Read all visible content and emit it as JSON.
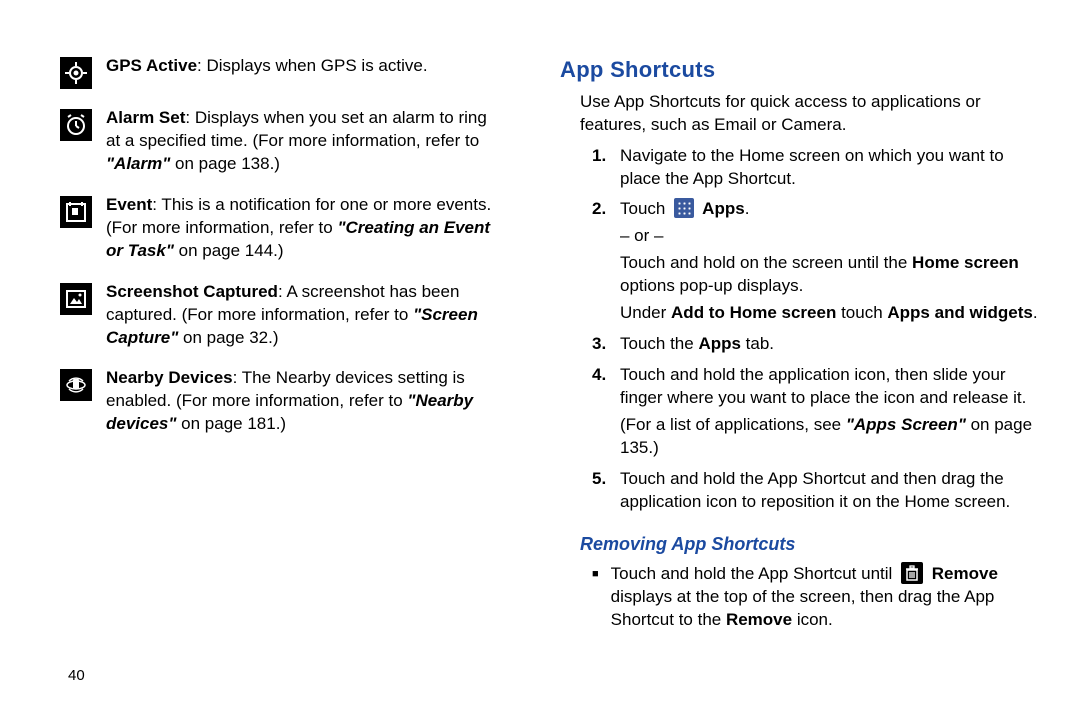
{
  "page_number": "40",
  "left": {
    "gps_bold": "GPS Active",
    "gps": ": Displays when GPS is active.",
    "alarm_bold": "Alarm Set",
    "alarm1": ": Displays when you set an alarm to ring at a specified time. (For more information, refer to ",
    "alarm_ref": "\"Alarm\"",
    "alarm2": " on page 138.)",
    "event_bold": "Event",
    "event1": ": This is a notification for one or more events. (For more information, refer to ",
    "event_ref": "\"Creating an Event or Task\"",
    "event2": " on page 144.)",
    "shot_bold": "Screenshot Captured",
    "shot1": ": A screenshot has been captured. (For more information, refer to ",
    "shot_ref": "\"Screen Capture\"",
    "shot2": " on page 32.)",
    "near_bold": "Nearby Devices",
    "near1": ": The Nearby devices setting is enabled. (For more information, refer to ",
    "near_ref": "\"Nearby devices\"",
    "near2": " on page 181.)"
  },
  "right": {
    "heading": "App Shortcuts",
    "intro": "Use App Shortcuts for quick access to applications or features, such as Email or Camera.",
    "s1_num": "1.",
    "s1": "Navigate to the Home screen on which you want to place the App Shortcut.",
    "s2_num": "2.",
    "s2a": "Touch ",
    "s2_apps": " Apps",
    "s2a2": ".",
    "s2_or": "– or –",
    "s2b1": "Touch and hold on the screen until the ",
    "s2b_bold": "Home screen",
    "s2b2": " options pop-up displays.",
    "s2c1": "Under ",
    "s2c_bold1": "Add to Home screen",
    "s2c2": " touch ",
    "s2c_bold2": "Apps and widgets",
    "s2c3": ".",
    "s3_num": "3.",
    "s3a": "Touch the ",
    "s3_bold": "Apps",
    "s3b": " tab.",
    "s4_num": "4.",
    "s4a": "Touch and hold the application icon, then slide your finger where you want to place the icon and release it.",
    "s4b1": "(For a list of applications, see ",
    "s4_ref": "\"Apps Screen\"",
    "s4b2": " on page 135.)",
    "s5_num": "5.",
    "s5": "Touch and hold the App Shortcut and then drag the application icon to reposition it on the Home screen.",
    "sub": "Removing App Shortcuts",
    "r1a": "Touch and hold the App Shortcut until ",
    "r1_remove": " Remove",
    "r1b": " displays at the top of the screen, then drag the App Shortcut to the ",
    "r1_bold": "Remove",
    "r1c": " icon."
  }
}
